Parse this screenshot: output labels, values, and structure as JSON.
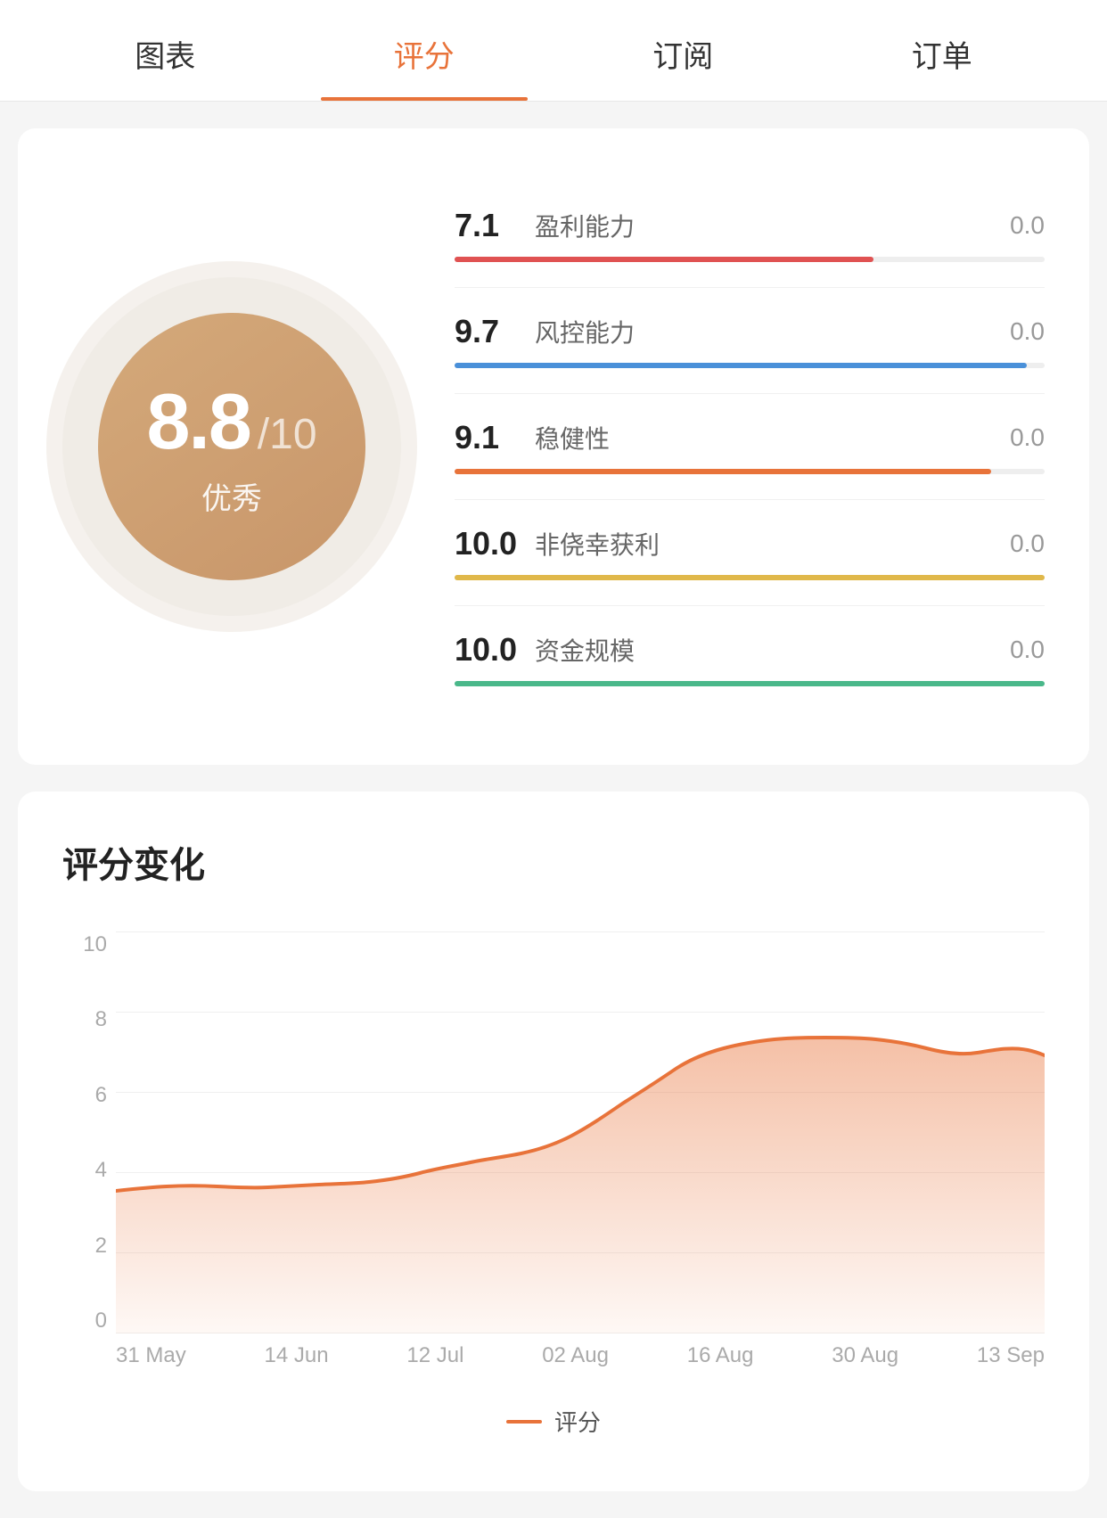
{
  "tabs": [
    {
      "id": "chart",
      "label": "图表",
      "active": false
    },
    {
      "id": "score",
      "label": "评分",
      "active": true
    },
    {
      "id": "subscribe",
      "label": "订阅",
      "active": false
    },
    {
      "id": "order",
      "label": "订单",
      "active": false
    }
  ],
  "scoreCard": {
    "score": "8.8",
    "outOf": "/10",
    "grade": "优秀",
    "metrics": [
      {
        "id": "profitability",
        "value": "7.1",
        "name": "盈利能力",
        "right": "0.0",
        "color": "#e05252",
        "fillPct": 71
      },
      {
        "id": "risk-control",
        "value": "9.7",
        "name": "风控能力",
        "right": "0.0",
        "color": "#4a90d9",
        "fillPct": 97
      },
      {
        "id": "stability",
        "value": "9.1",
        "name": "稳健性",
        "right": "0.0",
        "color": "#e8733a",
        "fillPct": 91
      },
      {
        "id": "non-lucky",
        "value": "10.0",
        "name": "非侥幸获利",
        "right": "0.0",
        "color": "#e0b84a",
        "fillPct": 100
      },
      {
        "id": "capital-scale",
        "value": "10.0",
        "name": "资金规模",
        "right": "0.0",
        "color": "#4ab88a",
        "fillPct": 100
      }
    ]
  },
  "chart": {
    "title": "评分变化",
    "yLabels": [
      "0",
      "2",
      "4",
      "6",
      "8",
      "10"
    ],
    "xLabels": [
      "31 May",
      "14 Jun",
      "12 Jul",
      "02 Aug",
      "16 Aug",
      "30 Aug",
      "13 Sep"
    ],
    "legendLabel": "评分",
    "legendColor": "#e8733a"
  }
}
